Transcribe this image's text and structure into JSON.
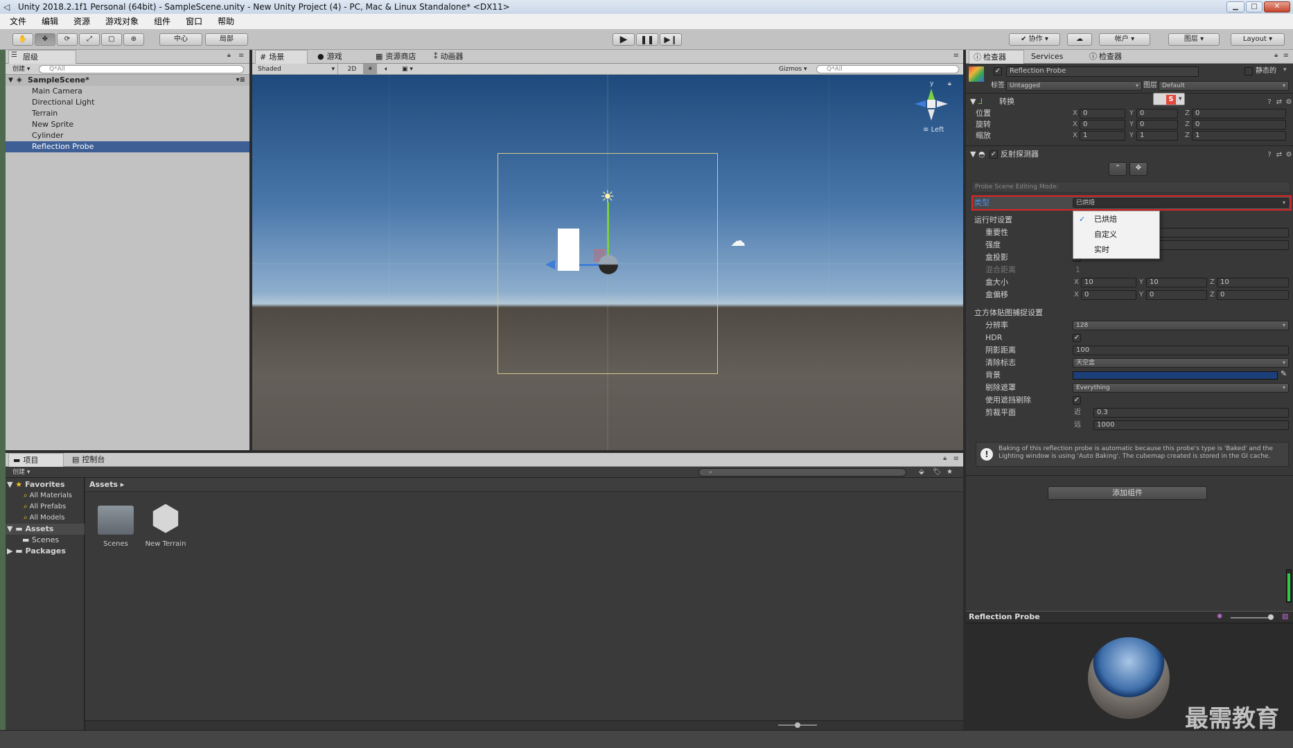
{
  "window": {
    "title": "Unity 2018.2.1f1 Personal (64bit) - SampleScene.unity - New Unity Project (4) - PC, Mac & Linux Standalone* <DX11>"
  },
  "menu": [
    "文件",
    "编辑",
    "资源",
    "游戏对象",
    "组件",
    "窗口",
    "帮助"
  ],
  "toolbar": {
    "pivot": "中心",
    "local": "局部",
    "collab": "协作",
    "account": "帐户",
    "layers": "图层",
    "layout": "Layout"
  },
  "hierarchy": {
    "tab": "层级",
    "create": "创建",
    "search_placeholder": "Q*All",
    "scene": "SampleScene*",
    "items": [
      "Main Camera",
      "Directional Light",
      "Terrain",
      "New Sprite",
      "Cylinder",
      "Reflection Probe"
    ],
    "selected_index": 5
  },
  "scene_view": {
    "tabs": [
      "场景",
      "游戏",
      "资源商店",
      "动画器"
    ],
    "shading": "Shaded",
    "mode2d": "2D",
    "gizmos": "Gizmos",
    "search_placeholder": "Q*All",
    "gizmo_label": "Left",
    "gizmo_y": "y"
  },
  "inspector": {
    "tabs": [
      "检查器",
      "Services",
      "检查器"
    ],
    "object_name": "Reflection Probe",
    "static_label": "静态的",
    "tag_label": "标签",
    "tag_value": "Untagged",
    "layer_label": "图层",
    "layer_value": "Default",
    "transform": {
      "header": "转换",
      "rows": [
        {
          "label": "位置",
          "x": "0",
          "y": "0",
          "z": "0"
        },
        {
          "label": "旋转",
          "x": "0",
          "y": "0",
          "z": "0"
        },
        {
          "label": "缩放",
          "x": "1",
          "y": "1",
          "z": "1"
        }
      ]
    },
    "probe": {
      "header": "反射探测器",
      "editing_mode": "Probe Scene Editing Mode:",
      "type_label": "类型",
      "type_value": "已烘焙",
      "dropdown_options": [
        "已烘焙",
        "自定义",
        "实时"
      ],
      "runtime_header": "运行时设置",
      "importance_label": "重要性",
      "intensity_label": "强度",
      "box_projection_label": "盒投影",
      "blend_label": "混合距离",
      "blend_value": "1",
      "box_size_label": "盒大小",
      "box_size": {
        "x": "10",
        "y": "10",
        "z": "10"
      },
      "box_offset_label": "盒偏移",
      "box_offset": {
        "x": "0",
        "y": "0",
        "z": "0"
      },
      "cubemap_header": "立方体贴图捕捉设置",
      "resolution_label": "分辨率",
      "resolution_value": "128",
      "hdr_label": "HDR",
      "shadow_label": "阴影距离",
      "shadow_value": "100",
      "clear_label": "清除标志",
      "clear_value": "天空盒",
      "background_label": "背景",
      "background_color": "#1c3f7a",
      "culling_label": "剔除遮罩",
      "culling_value": "Everything",
      "occlusion_label": "使用遮挡剔除",
      "clip_label": "剪裁平面",
      "near_label": "近",
      "near_value": "0.3",
      "far_label": "远",
      "far_value": "1000"
    },
    "info": "Baking of this reflection probe is automatic because this probe's type is 'Baked' and the Lighting window is using 'Auto Baking'. The cubemap created is stored in the GI cache.",
    "add_component": "添加组件",
    "preview_title": "Reflection Probe"
  },
  "project": {
    "tabs": [
      "项目",
      "控制台"
    ],
    "create": "创建",
    "favorites": "Favorites",
    "fav_items": [
      "All Materials",
      "All Prefabs",
      "All Models"
    ],
    "assets": "Assets",
    "asset_children": [
      "Scenes"
    ],
    "packages": "Packages",
    "breadcrumb": "Assets ▸",
    "files": [
      "Scenes",
      "New Terrain"
    ]
  },
  "watermark": "最需教育"
}
